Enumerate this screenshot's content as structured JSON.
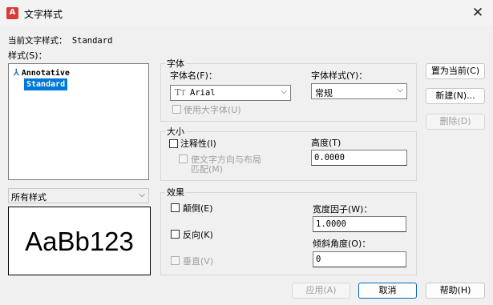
{
  "window": {
    "title": "文字样式",
    "app_icon_text": "A"
  },
  "current_style": "当前文字样式： Standard",
  "styles_label": "样式(S)：",
  "style_list": [
    "Annotative",
    "Standard"
  ],
  "filter_select": {
    "value": "所有样式"
  },
  "preview_text": "AaBb123",
  "font_group": {
    "title": "字体",
    "font_name_label": "字体名(F)：",
    "font_name_value": "Arial",
    "font_style_label": "字体样式(Y)：",
    "font_style_value": "常规",
    "big_font_label": "使用大字体(U)"
  },
  "size_group": {
    "title": "大小",
    "annotative_label": "注释性(I)",
    "match_orientation_line1": "使文字方向与布局",
    "match_orientation_line2": "匹配(M)",
    "height_label": "高度(T)",
    "height_value": "0.0000"
  },
  "effects_group": {
    "title": "效果",
    "upside_down_label": "颠倒(E)",
    "backwards_label": "反向(K)",
    "vertical_label": "垂直(V)",
    "width_factor_label": "宽度因子(W)：",
    "width_factor_value": "1.0000",
    "oblique_angle_label": "倾斜角度(O)：",
    "oblique_angle_value": "0"
  },
  "buttons": {
    "set_current": "置为当前(C)",
    "new": "新建(N)...",
    "delete": "删除(D)",
    "apply": "应用(A)",
    "cancel": "取消",
    "help": "帮助(H)"
  },
  "colors": {
    "selection": "#0078d7",
    "app_icon": "#d83a3a",
    "primary_border": "#0067c0"
  }
}
